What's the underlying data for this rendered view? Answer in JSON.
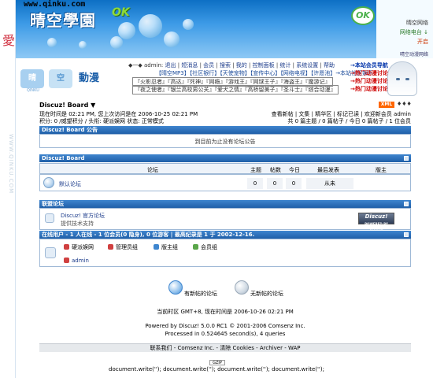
{
  "banner": {
    "url": "www.qinku.com",
    "logo_text": "晴空學園",
    "logo_ok": "OK",
    "ok_badge": "OK",
    "right_links": [
      "晴空网络",
      "网络电台 ↓",
      "开启",
      "晴空动漫网络"
    ]
  },
  "side": {
    "ai_char": "愛",
    "side_url": "WWW.QINKU.COM"
  },
  "anime_logo": {
    "seg1": "晴",
    "seg2": "空",
    "sub": "QINKU",
    "title": "動漫"
  },
  "userbar": {
    "prefix": "◆一◆ admin:",
    "items": [
      "退出",
      "短消息",
      "会员",
      "搜索",
      "我的",
      "控制面板",
      "统计",
      "系统设置",
      "帮助"
    ]
  },
  "notices": {
    "n1": "→本站会员导航",
    "n2": "→热门动漫讨论",
    "n3": "→热门动漫讨论",
    "n4": "→热门动漫讨论"
  },
  "linkbar1": "【晴空MP3】【社区银行】【天使宠物】【宣传中心】【网络电视】【许愿池】→本站社区娱乐",
  "linkbar2": "『火影忍者』『高达』『死神』『网瘾』『游戏王』『网球王子』『海盗王』『魔游记』",
  "linkbar3": "『夜之使者』『银兰高校男公关』『爱犬之情』『高桥留美子』『圣斗士』『综合动漫』",
  "forum_header": {
    "crumb": "Discuz! Board ▼",
    "xml": "XML",
    "arrows": "♦♦♦",
    "time_line1": "现在时间是 02:21 PM, 您上次访问是在 2006-10-25 02:21 PM",
    "time_line2": "积分: 0 /威望积分 / 头衔: 硬派娱网 状态: 正常模式",
    "right_line1": "查看新帖 | 文集 | 精华区 | 标记已读 | 欢迎新会员 admin",
    "right_line2": "共 0 篇主题 / 0 篇帖子 / 今日 0 篇帖子 / 1 位会员"
  },
  "announcement": {
    "title": "Discuz! Board 公告",
    "body": "到目前为止没有论坛公告"
  },
  "board": {
    "title": "Discuz! Board",
    "columns": [
      "论坛",
      "主题",
      "帖数",
      "今日",
      "最后发表",
      "版主"
    ],
    "forum_name": "默认论坛",
    "topics": "0",
    "posts": "0",
    "today": "0",
    "last": "从未"
  },
  "league": {
    "title": "联盟论坛",
    "name": "Discuz! 官方论坛",
    "desc": "提供技术支持",
    "badge_line1": "Discuz!",
    "badge_line2": "POWERED BY DISCUZ"
  },
  "online": {
    "title": "在线用户 - 1 人在线 - 1 位会员(0 隐身), 0 位游客 | 最高纪录是 1 于 2002-12-16.",
    "groups": [
      "硬派娱网",
      "管理员组",
      "版主组",
      "会员组"
    ],
    "users": [
      "admin"
    ]
  },
  "legend": {
    "new": "有新帖的论坛",
    "nonew": "无新帖的论坛"
  },
  "stats": {
    "line1": "当前时区 GMT+8, 现在时间是 2006-10-26 02:21 PM",
    "line2": "Powered by Discuz! 5.0.0 RC1 © 2001-2006 Comsenz Inc.",
    "line3": "Processed in 0.524645 second(s), 4 queries"
  },
  "footer": {
    "links": "联系我们 - Comsenz Inc. - 清除 Cookies - Archiver - WAP",
    "gzip": "GZIP",
    "docwrite": "document.write(''); document.write(''); document.write(''); document.write('');"
  },
  "colors": {
    "cathead": "#1f5fa8",
    "accent_red": "#cc0000",
    "xml": "#ff6600"
  }
}
